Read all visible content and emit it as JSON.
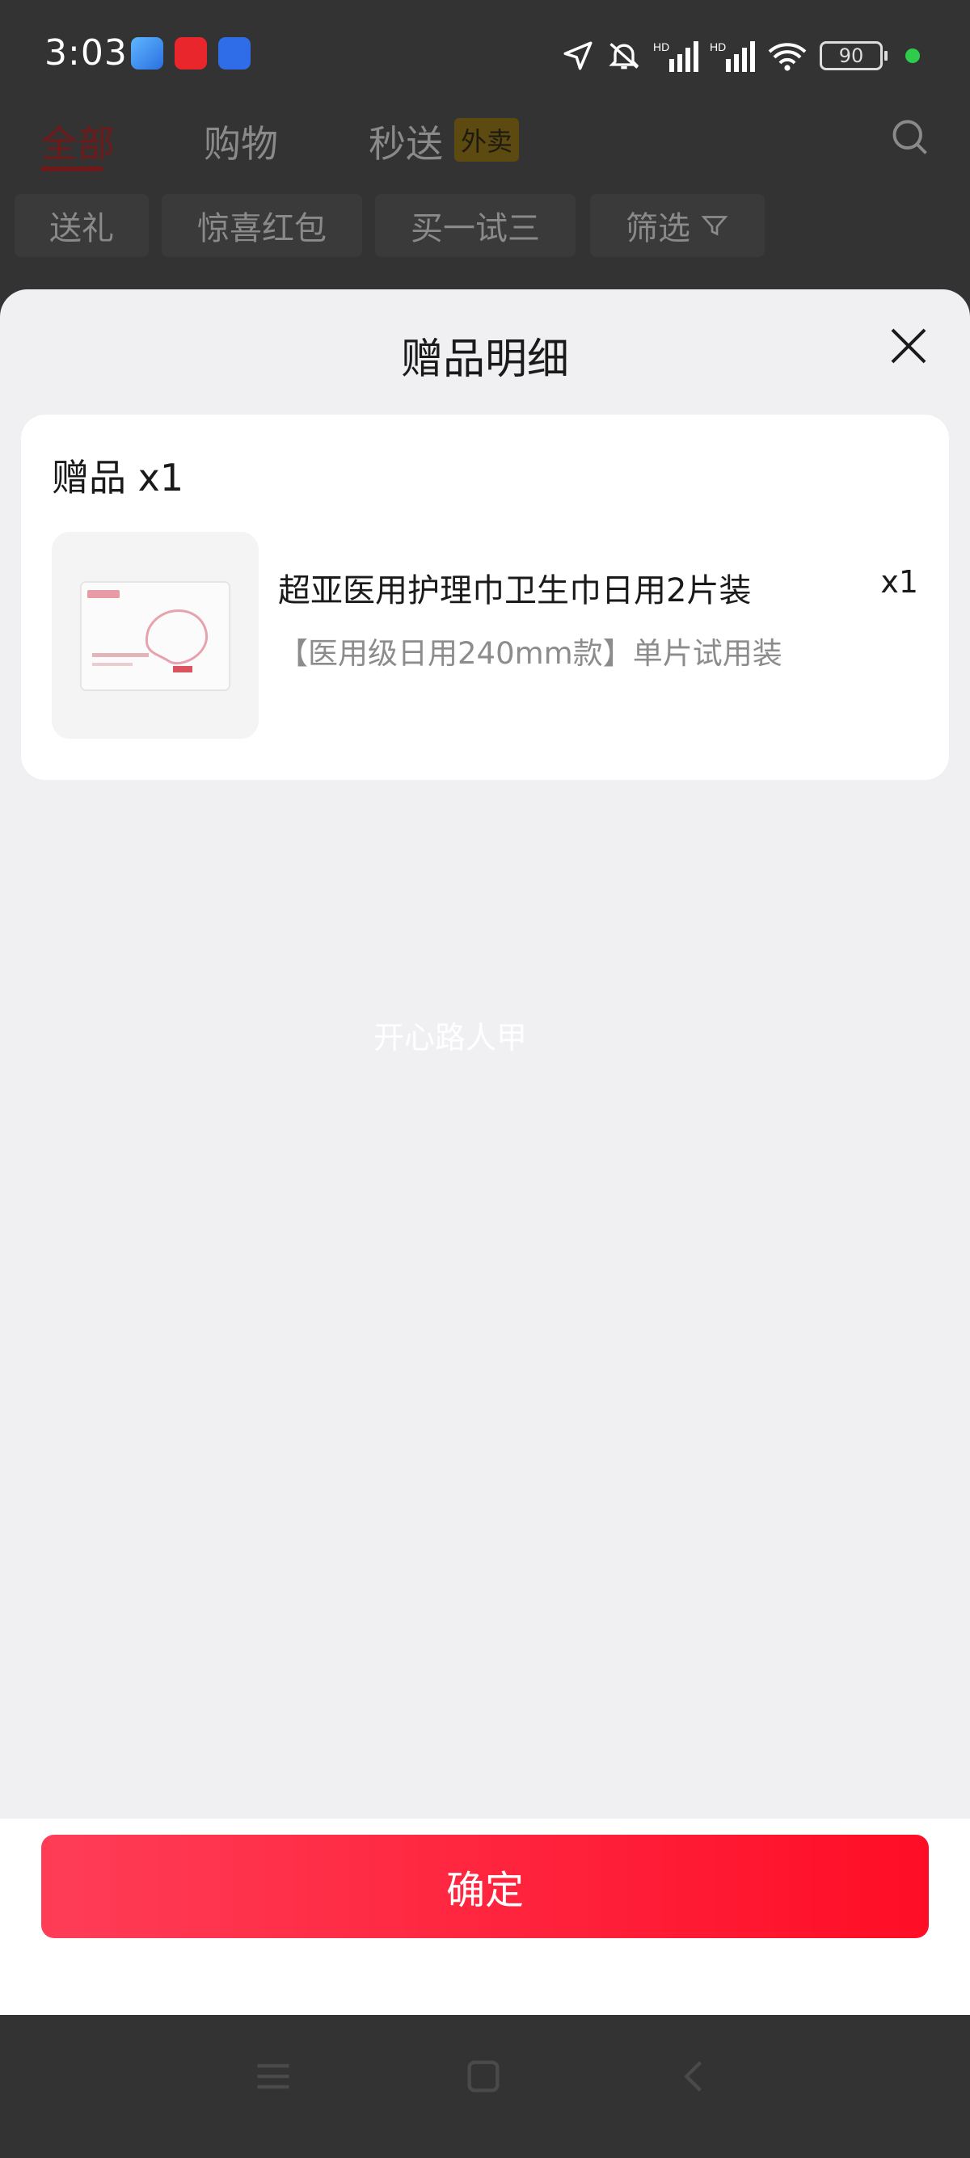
{
  "status_bar": {
    "time": "3:03",
    "battery": "90"
  },
  "background_tabs": {
    "tabs": [
      {
        "label": "全部"
      },
      {
        "label": "购物"
      },
      {
        "label": "秒送"
      }
    ],
    "badge": "外卖",
    "chips": [
      "送礼",
      "惊喜红包",
      "买一试三",
      "筛选"
    ]
  },
  "sheet": {
    "title": "赠品明细",
    "section_header": "赠品 x1",
    "item": {
      "name": "超亚医用护理巾卫生巾日用2片装",
      "quantity": "x1",
      "spec": "【医用级日用240mm款】单片试用装"
    },
    "watermark": "开心路人甲",
    "confirm_label": "确定"
  },
  "colors": {
    "accent": "#ff1a33",
    "sheet_bg": "#f0f0f2"
  }
}
